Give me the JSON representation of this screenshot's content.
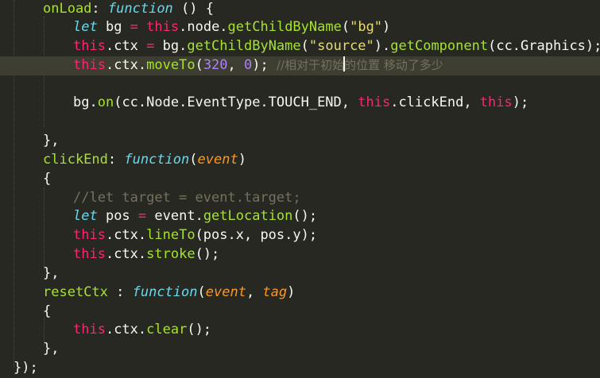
{
  "editor": {
    "theme_colors": {
      "background": "#272822",
      "current_line": "#3e3d32",
      "plain": "#f8f8f2",
      "function_name": "#a6e22e",
      "storage": "#66d9ef",
      "keyword": "#f92672",
      "parameter": "#fd971f",
      "string": "#e6db74",
      "number": "#ae81ff",
      "comment": "#75715e"
    },
    "lines": [
      {
        "tokens": [
          "onLoad",
          ": ",
          "function",
          " () {"
        ]
      },
      {
        "tokens": [
          "let",
          " bg ",
          "=",
          " ",
          "this",
          ".node.",
          "getChildByName",
          "(",
          "\"bg\"",
          ")"
        ]
      },
      {
        "tokens": [
          "this",
          ".ctx ",
          "=",
          " bg.",
          "getChildByName",
          "(",
          "\"source\"",
          ").",
          "getComponent",
          "(cc.Graphics);"
        ]
      },
      {
        "tokens": [
          "this",
          ".ctx.",
          "moveTo",
          "(",
          "320",
          ", ",
          "0",
          "); ",
          "//相对于初始",
          "的位置 移动了多少"
        ]
      },
      {
        "tokens": []
      },
      {
        "tokens": [
          "bg.",
          "on",
          "(cc.Node.EventType.TOUCH_END, ",
          "this",
          ".clickEnd, ",
          "this",
          ");"
        ]
      },
      {
        "tokens": []
      },
      {
        "tokens": [
          "},"
        ]
      },
      {
        "tokens": [
          "clickEnd",
          ": ",
          "function",
          "(",
          "event",
          ")"
        ]
      },
      {
        "tokens": [
          "{"
        ]
      },
      {
        "tokens": [
          "//let target = event.target;"
        ]
      },
      {
        "tokens": [
          "let",
          " pos ",
          "=",
          " event.",
          "getLocation",
          "();"
        ]
      },
      {
        "tokens": [
          "this",
          ".ctx.",
          "lineTo",
          "(pos.x, pos.y);"
        ]
      },
      {
        "tokens": [
          "this",
          ".ctx.",
          "stroke",
          "();"
        ]
      },
      {
        "tokens": [
          "},"
        ]
      },
      {
        "tokens": [
          "resetCtx",
          " : ",
          "function",
          "(",
          "event",
          ", ",
          "tag",
          ")"
        ]
      },
      {
        "tokens": [
          "{"
        ]
      },
      {
        "tokens": [
          "this",
          ".ctx.",
          "clear",
          "();"
        ]
      },
      {
        "tokens": [
          "},"
        ]
      },
      {
        "tokens": [
          "});"
        ]
      }
    ]
  }
}
